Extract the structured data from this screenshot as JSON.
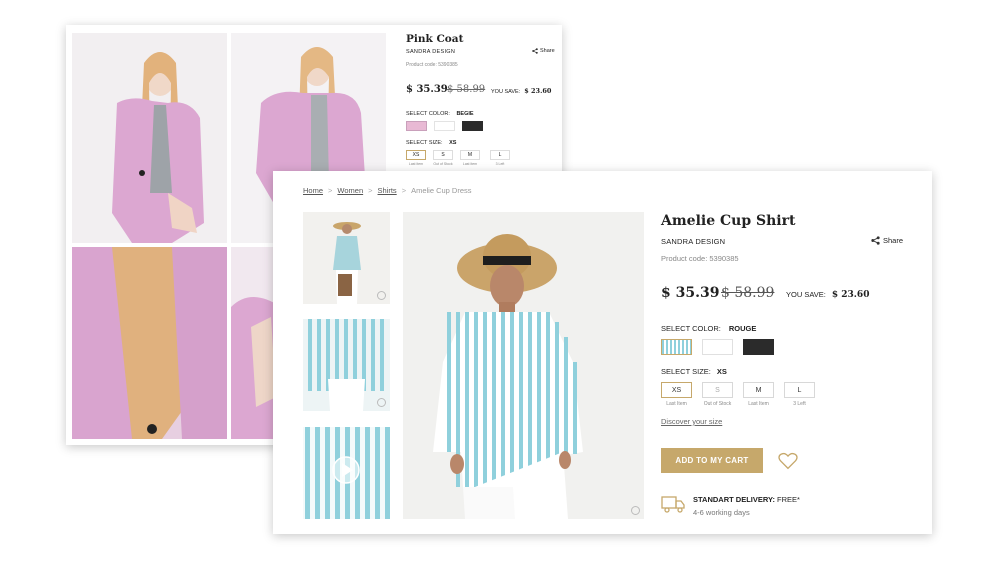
{
  "back_product": {
    "title": "Pink Coat",
    "brand": "SANDRA DESIGN",
    "share": "Share",
    "product_code": "Product code: 5390385",
    "price": "$ 35.39",
    "old_price": "$ 58.99",
    "you_save_label": "YOU SAVE:",
    "you_save_value": "$ 23.60",
    "color_label": "SELECT COLOR:",
    "color_value": "BEGIE",
    "colors": [
      "#e8b9d4",
      "#ffffff",
      "#2b2b2b"
    ],
    "size_label": "SELECT SIZE:",
    "size_value": "XS",
    "sizes": [
      {
        "label": "XS",
        "note": "Last item"
      },
      {
        "label": "S",
        "note": "Out of Stock"
      },
      {
        "label": "M",
        "note": "Last item"
      },
      {
        "label": "L",
        "note": "3 Left"
      }
    ]
  },
  "front_product": {
    "breadcrumb": [
      "Home",
      "Women",
      "Shirts",
      "Amelie Cup Dress"
    ],
    "title": "Amelie Cup Shirt",
    "brand": "SANDRA DESIGN",
    "share": "Share",
    "product_code": "Product code: 5390385",
    "price": "$ 35.39",
    "old_price": "$ 58.99",
    "you_save_label": "YOU SAVE:",
    "you_save_value": "$ 23.60",
    "color_label": "SELECT COLOR:",
    "color_value": "ROUGE",
    "colors": [
      "#a9d6de",
      "#ffffff",
      "#2b2b2b"
    ],
    "size_label": "SELECT SIZE:",
    "size_value": "XS",
    "sizes": [
      {
        "label": "XS",
        "note": "Last Item"
      },
      {
        "label": "S",
        "note": "Out of Stock"
      },
      {
        "label": "M",
        "note": "Last Item"
      },
      {
        "label": "L",
        "note": "3 Left"
      }
    ],
    "discover_size": "Discover your size",
    "add_to_cart": "ADD TO MY CART",
    "delivery_label": "STANDART DELIVERY:",
    "delivery_value": "FREE*",
    "delivery_days": "4-6 working days"
  },
  "colors": {
    "accent_gold": "#c6a86b",
    "coat_pink": "#dba6cf",
    "stripe_blue": "#8fd0dc"
  },
  "icons": [
    "share-icon",
    "zoom-icon",
    "play-icon",
    "heart-icon",
    "truck-icon"
  ]
}
